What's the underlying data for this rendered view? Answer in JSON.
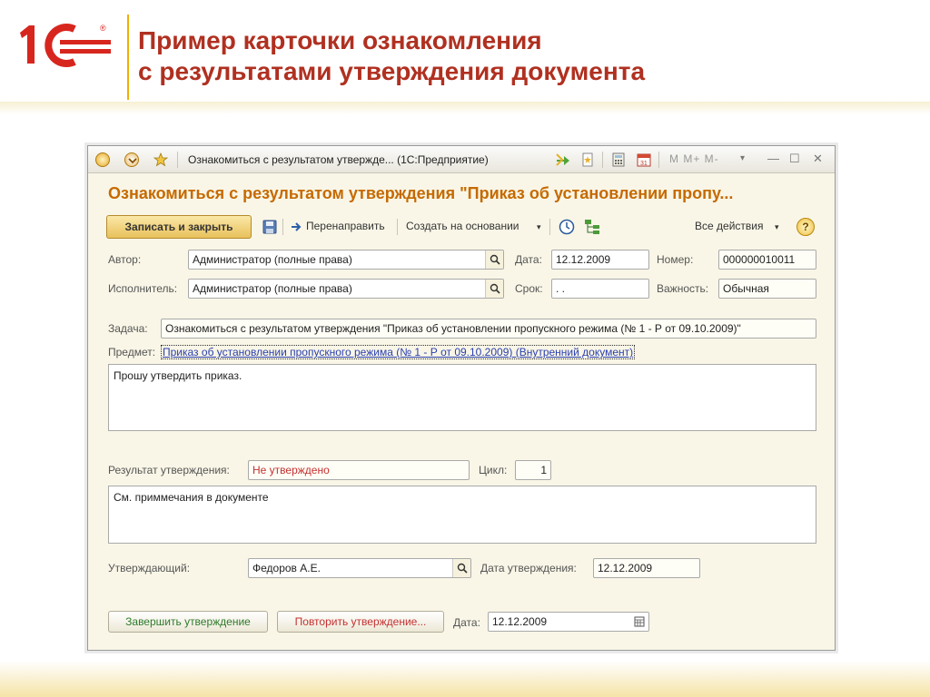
{
  "slide": {
    "logo_text": "1С",
    "title_line1": "Пример карточки ознакомления",
    "title_line2": "с результатами утверждения документа"
  },
  "window": {
    "title": "Ознакомиться с результатом утвержде...  (1С:Предприятие)",
    "m_buttons": "M  M+  M-",
    "minimize": "—",
    "maximize": "☐",
    "close": "✕"
  },
  "form": {
    "heading": "Ознакомиться с результатом утверждения \"Приказ об установлении пропу...",
    "toolbar": {
      "save_close": "Записать и закрыть",
      "redirect": "Перенаправить",
      "create_based": "Создать на основании",
      "all_actions": "Все действия",
      "help": "?"
    },
    "author_label": "Автор:",
    "author_value": "Администратор (полные права)",
    "date_label": "Дата:",
    "date_value": "12.12.2009",
    "number_label": "Номер:",
    "number_value": "000000010011",
    "executor_label": "Исполнитель:",
    "executor_value": "Администратор (полные права)",
    "deadline_label": "Срок:",
    "deadline_value": " .  .",
    "importance_label": "Важность:",
    "importance_value": "Обычная",
    "task_label": "Задача:",
    "task_value": "Ознакомиться с результатом утверждения \"Приказ об установлении пропускного режима (№ 1 - Р от 09.10.2009)\"",
    "subject_label": "Предмет:",
    "subject_link": "Приказ об установлении пропускного режима (№ 1 - Р от 09.10.2009) (Внутренний документ)",
    "description": "Прошу утвердить приказ.",
    "result_label": "Результат утверждения:",
    "result_value": "Не утверждено",
    "cycle_label": "Цикл:",
    "cycle_value": "1",
    "comment": "См. приммечания в документе",
    "approver_label": "Утверждающий:",
    "approver_value": "Федоров А.Е.",
    "approval_date_label": "Дата утверждения:",
    "approval_date_value": "12.12.2009",
    "finish_button": "Завершить утверждение",
    "repeat_button": "Повторить утверждение...",
    "bottom_date_label": "Дата:",
    "bottom_date_value": "12.12.2009"
  },
  "colors": {
    "accent_title": "#b03020",
    "form_heading": "#c66a00",
    "error_text": "#c43030",
    "link": "#2a3fb0"
  }
}
